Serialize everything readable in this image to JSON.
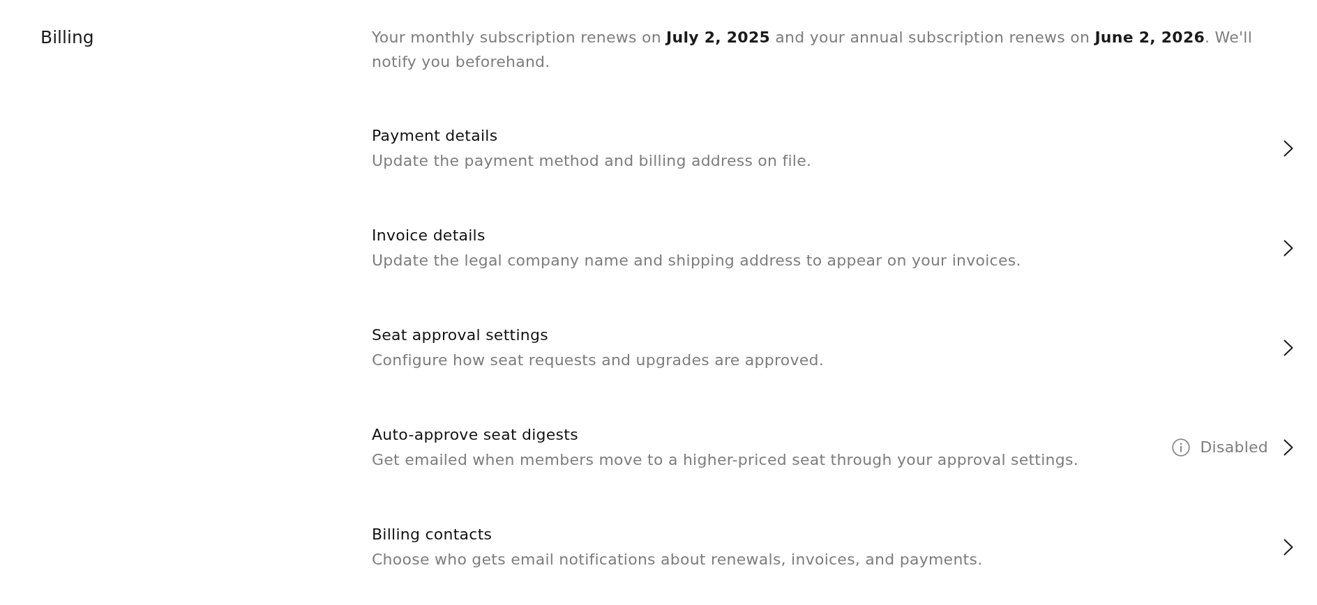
{
  "section": {
    "title": "Billing"
  },
  "intro": "Your monthly subscription renews on **July 2, 2025** and your annual subscription renews on **June 2, 2026**. We'll notify you beforehand.",
  "rows": [
    {
      "title": "Payment details",
      "description": "Update the payment method and billing address on file."
    },
    {
      "title": "Invoice details",
      "description": "Update the legal company name and shipping address to appear on your invoices."
    },
    {
      "title": "Seat approval settings",
      "description": "Configure how seat requests and upgrades are approved."
    },
    {
      "title": "Auto-approve seat digests",
      "description": "Get emailed when members move to a higher-priced seat through your approval settings.",
      "status": {
        "kind": "info",
        "label": "Disabled"
      }
    },
    {
      "title": "Billing contacts",
      "description": "Choose who gets email notifications about renewals, invoices, and payments."
    }
  ]
}
